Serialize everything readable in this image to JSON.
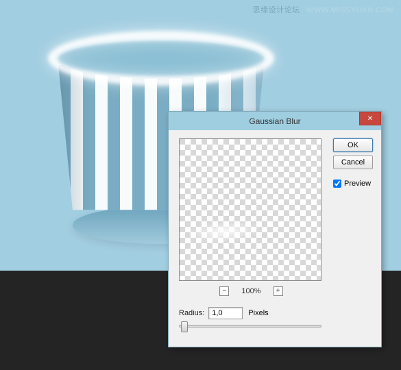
{
  "watermark": {
    "cn": "思缘设计论坛",
    "url": "WWW.MISSYUAN.COM"
  },
  "dialog": {
    "title": "Gaussian Blur",
    "close_label": "✕",
    "ok_label": "OK",
    "cancel_label": "Cancel",
    "preview_label": "Preview",
    "preview_checked": true,
    "zoom": {
      "minus_label": "−",
      "plus_label": "+",
      "value": "100%"
    },
    "radius": {
      "label": "Radius:",
      "value": "1,0",
      "unit": "Pixels"
    }
  }
}
